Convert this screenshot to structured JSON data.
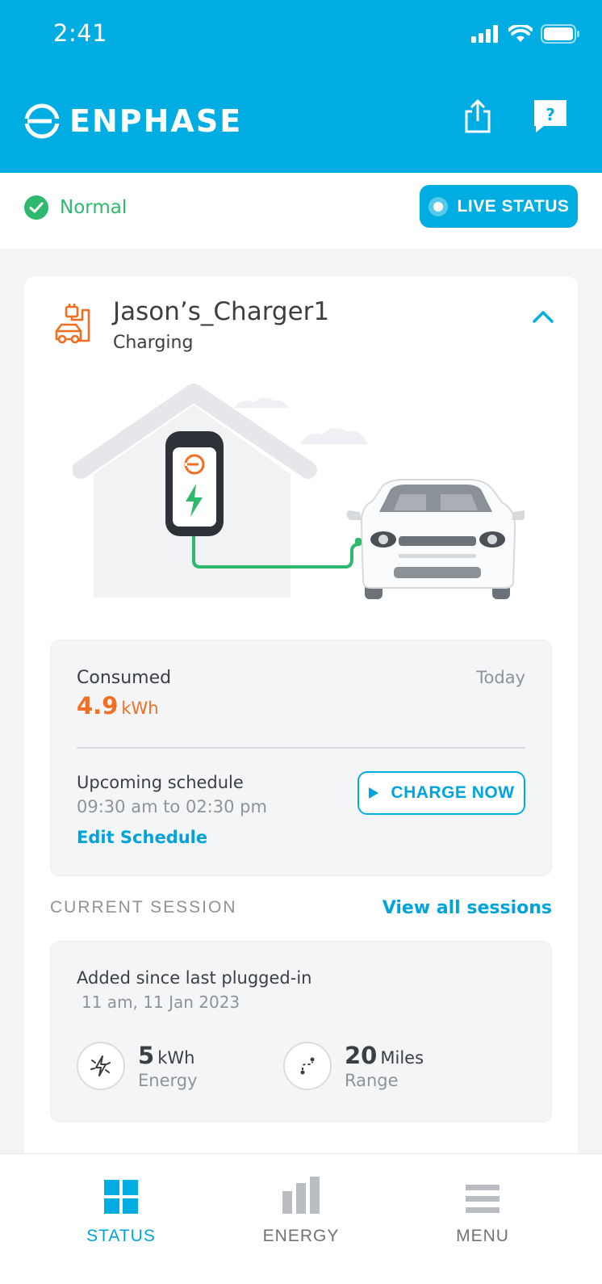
{
  "status_bar": {
    "time": "2:41"
  },
  "header": {
    "brand": "ENPHASE"
  },
  "system_status": {
    "label": "Normal",
    "live_button": "LIVE STATUS"
  },
  "charger": {
    "name": "Jason’s_Charger1",
    "state": "Charging",
    "consumed_label": "Consumed",
    "period": "Today",
    "consumed_value": "4.9",
    "consumed_unit": "kWh",
    "schedule_label": "Upcoming schedule",
    "schedule_time": "09:30 am to 02:30 pm",
    "edit_schedule": "Edit Schedule",
    "charge_now": "CHARGE NOW"
  },
  "session": {
    "section_label": "CURRENT SESSION",
    "view_all": "View all sessions",
    "added_label": "Added since last plugged-in",
    "added_time": "11 am, 11 Jan 2023",
    "energy_value": "5",
    "energy_unit": "kWh",
    "energy_label": "Energy",
    "range_value": "20",
    "range_unit": "Miles",
    "range_label": "Range"
  },
  "nav": {
    "items": [
      {
        "label": "STATUS",
        "icon": "grid-icon",
        "active": true
      },
      {
        "label": "ENERGY",
        "icon": "bar-chart-icon",
        "active": false
      },
      {
        "label": "MENU",
        "icon": "hamburger-icon",
        "active": false
      }
    ]
  },
  "colors": {
    "brand": "#00ade3",
    "accent_orange": "#f26f21",
    "status_green": "#2fb96f",
    "inactive_gray": "#8e9398"
  }
}
